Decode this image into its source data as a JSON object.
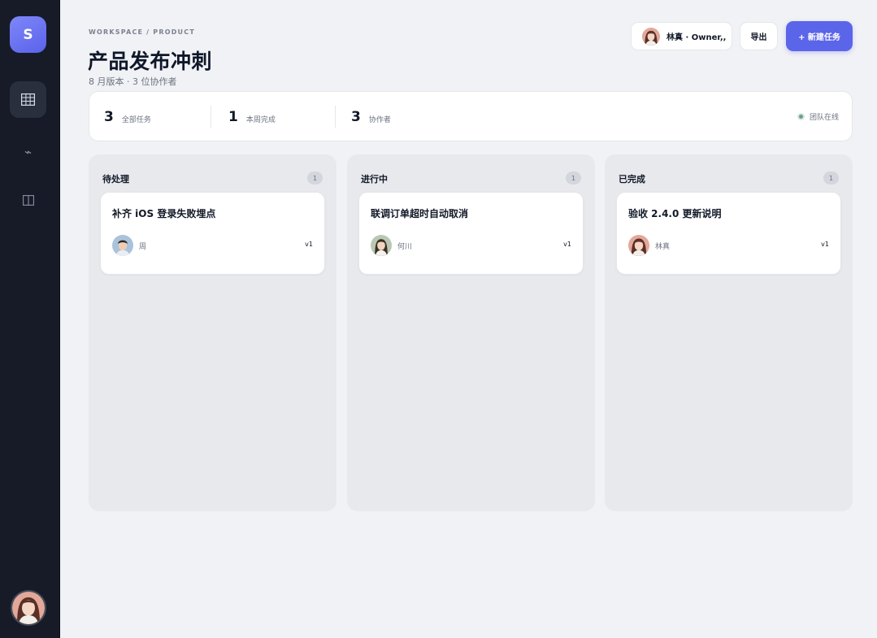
{
  "app": {
    "logo_letter": "S",
    "colors": {
      "accent": "#5b65ea",
      "sidebar": "#171b27",
      "background": "#f1f2f5",
      "online": "#6f9c8e"
    }
  },
  "sidebar": {
    "items": [
      {
        "icon": "grid-icon",
        "active": true
      },
      {
        "icon": "activity-icon",
        "glyph": "⌁",
        "active": false
      },
      {
        "icon": "columns-icon",
        "active": false
      }
    ]
  },
  "header": {
    "breadcrumb": "WORKSPACE / PRODUCT",
    "title": "产品发布冲刺",
    "subtitle": "8 月版本 · 3 位协作者",
    "user_chip": "林真 · Owner,,",
    "export_label": "导出",
    "new_task_label": "+ 新建任务"
  },
  "stats": {
    "items": [
      {
        "value": "3",
        "label": "全部任务"
      },
      {
        "value": "1",
        "label": "本周完成"
      },
      {
        "value": "3",
        "label": "协作者"
      }
    ],
    "online_label": "团队在线"
  },
  "board": {
    "columns": [
      {
        "title": "待处理",
        "count": "1",
        "card": {
          "title": "补齐 iOS 登录失败埋点",
          "assignee": "周",
          "version": "v1"
        }
      },
      {
        "title": "进行中",
        "count": "1",
        "card": {
          "title": "联调订单超时自动取消",
          "assignee": "何川",
          "version": "v1"
        }
      },
      {
        "title": "已完成",
        "count": "1",
        "card": {
          "title": "验收 2.4.0 更新说明",
          "assignee": "林真",
          "version": "v1"
        }
      }
    ]
  }
}
